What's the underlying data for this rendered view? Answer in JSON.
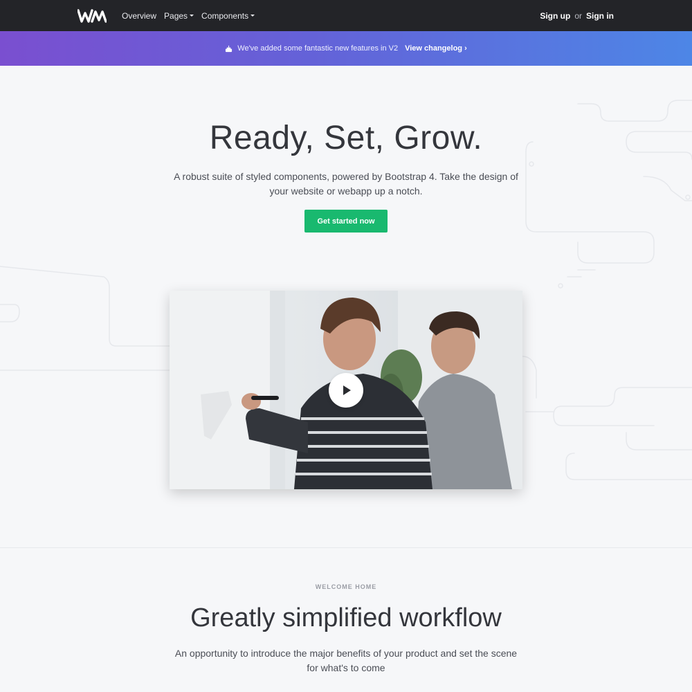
{
  "nav": {
    "links": [
      {
        "label": "Overview",
        "dropdown": false
      },
      {
        "label": "Pages",
        "dropdown": true
      },
      {
        "label": "Components",
        "dropdown": true
      }
    ],
    "sign_up": "Sign up",
    "or": "or",
    "sign_in": "Sign in"
  },
  "announcement": {
    "icon": "cake-icon",
    "text": "We've added some fantastic new features in V2",
    "link": "View changelog ›"
  },
  "hero": {
    "title": "Ready, Set, Grow.",
    "subtitle": "A robust suite of styled components, powered by Bootstrap 4. Take the design of your website or webapp up a notch.",
    "cta": "Get started now"
  },
  "video": {
    "play_icon": "play-icon"
  },
  "section": {
    "eyebrow": "WELCOME HOME",
    "title": "Greatly simplified workflow",
    "subtitle": "An opportunity to introduce the major benefits of your product and set the scene for what's to come"
  },
  "colors": {
    "navbar": "#232428",
    "accent_green": "#19b96f",
    "banner_start": "#7a4fd0",
    "banner_end": "#4d86e6",
    "background": "#f6f7f9"
  }
}
